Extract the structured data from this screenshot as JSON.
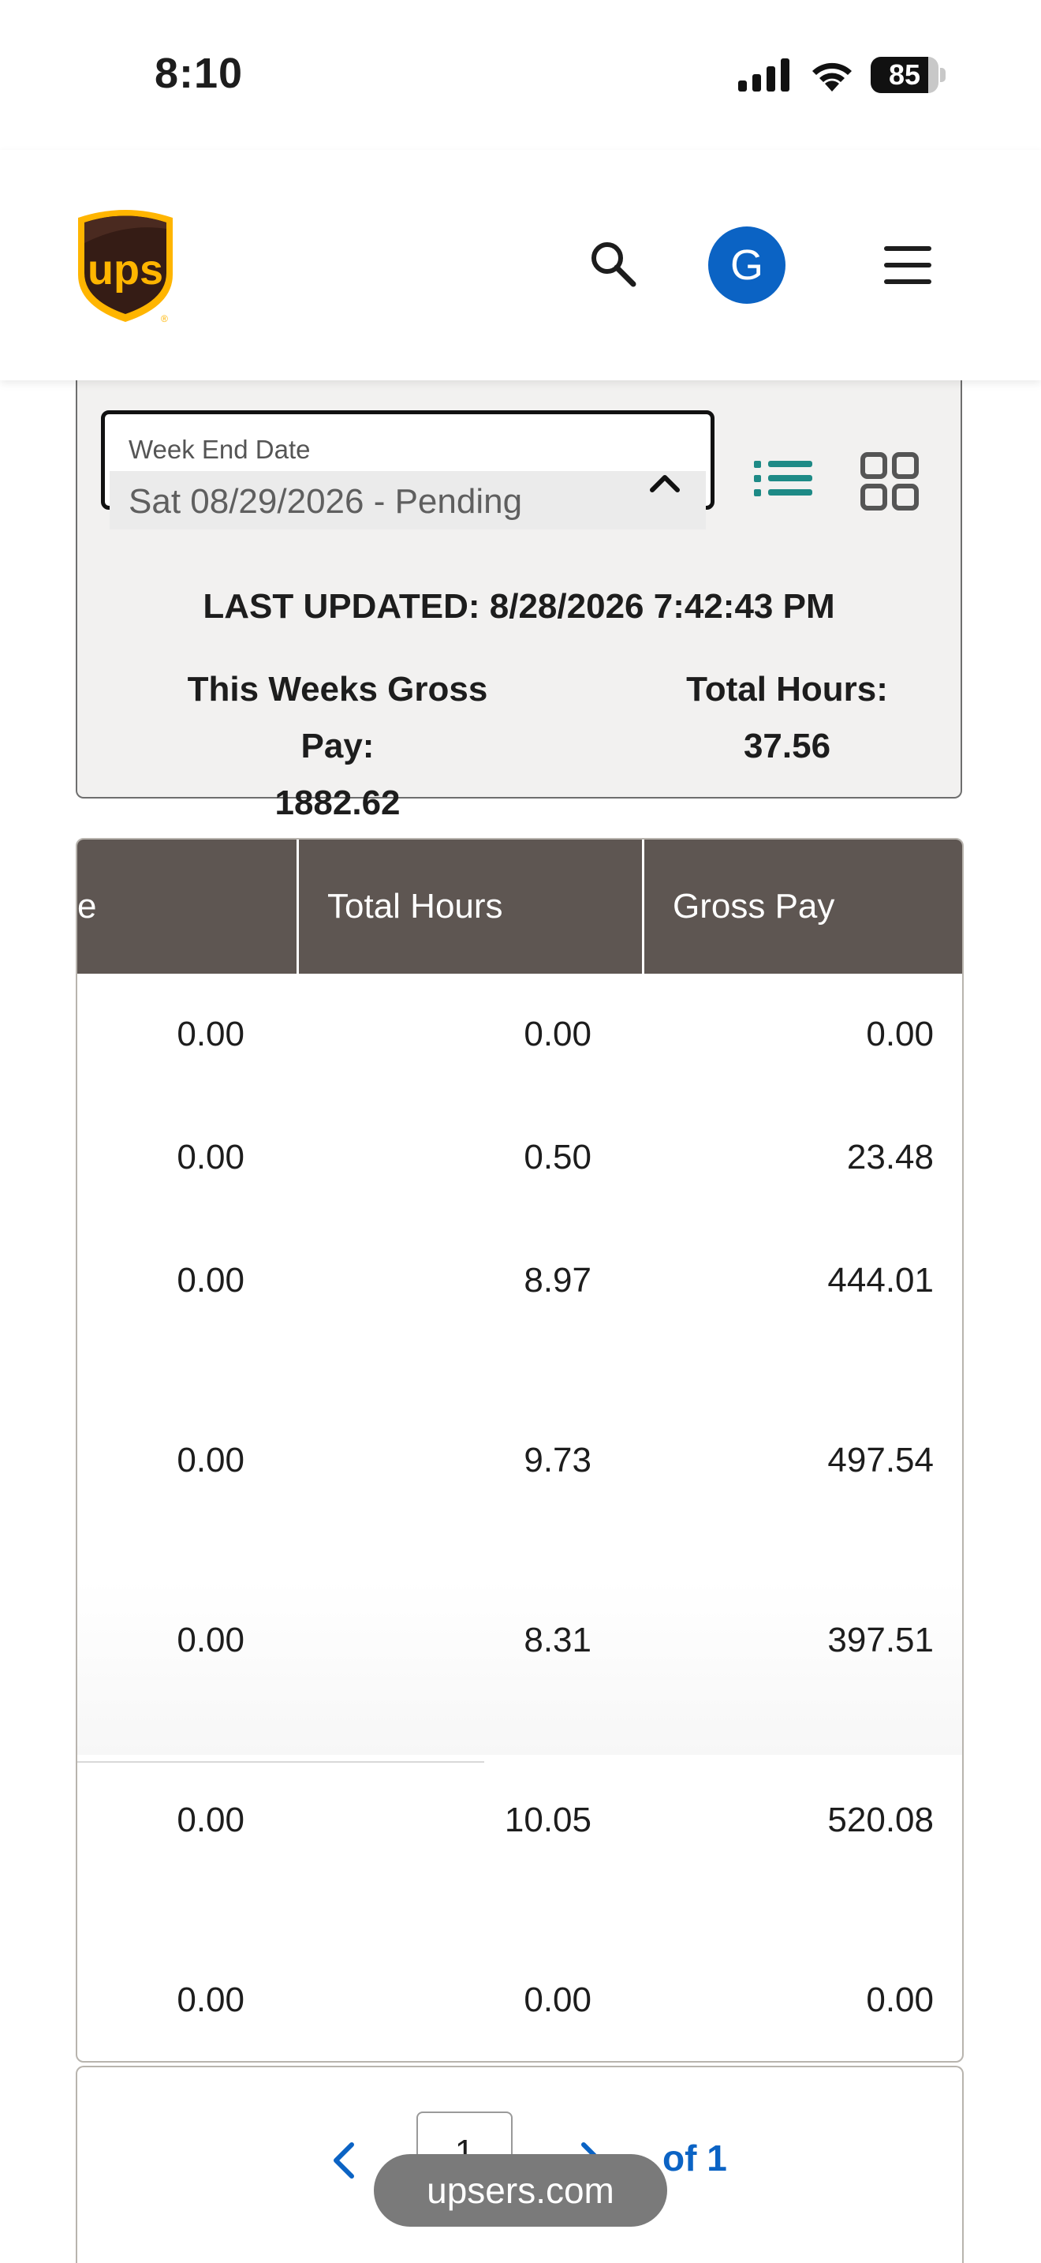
{
  "status_bar": {
    "time": "8:10",
    "battery": {
      "level_text": "85",
      "level_fraction": 0.85
    },
    "icons": [
      "signal-icon",
      "wifi-icon",
      "battery-icon"
    ]
  },
  "header": {
    "logo_text": "ups",
    "avatar_initial": "G",
    "icons": [
      "search-icon",
      "menu-icon"
    ]
  },
  "summary": {
    "week_select": {
      "label": "Week End Date",
      "value": "Sat 08/29/2026 - Pending"
    },
    "view_icons": [
      "list-view-icon",
      "grid-view-icon"
    ],
    "last_updated": "LAST UPDATED: 8/28/2026 7:42:43 PM",
    "gross_pay_label": "This Weeks Gross Pay:",
    "gross_pay_value": "1882.62",
    "total_hours_label": "Total Hours:",
    "total_hours_value": "37.56"
  },
  "table": {
    "columns": [
      "e",
      "Total Hours",
      "Gross Pay"
    ],
    "rows": [
      [
        "0.00",
        "0.00",
        "0.00"
      ],
      [
        "0.00",
        "0.50",
        "23.48"
      ],
      [
        "0.00",
        "8.97",
        "444.01"
      ],
      [
        "0.00",
        "9.73",
        "497.54"
      ],
      [
        "0.00",
        "8.31",
        "397.51"
      ],
      [
        "0.00",
        "10.05",
        "520.08"
      ],
      [
        "0.00",
        "0.00",
        "0.00"
      ]
    ]
  },
  "pagination": {
    "current_page": "1",
    "of_text": "of 1"
  },
  "browser": {
    "url": "upsers.com"
  },
  "colors": {
    "ups_brown": "#351c15",
    "ups_gold": "#ffb500",
    "header_row": "#5e5652",
    "link_blue": "#0b63c4",
    "teal_icon": "#1e8a86"
  }
}
